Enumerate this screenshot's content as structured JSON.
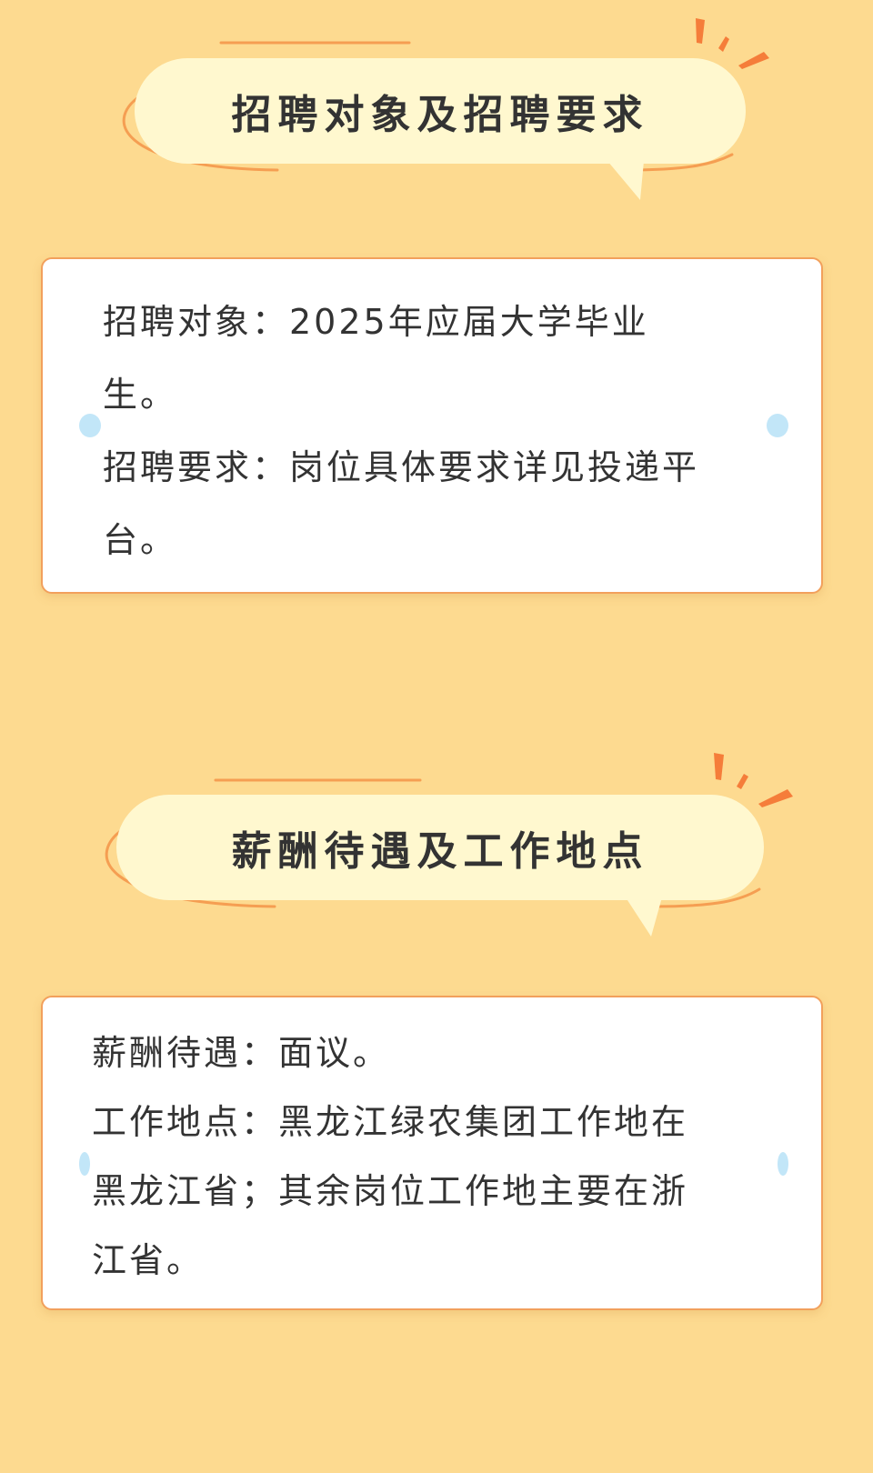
{
  "sections": [
    {
      "title": "招聘对象及招聘要求",
      "lines": [
        "招聘对象：2025年应届大学毕业",
        "生。",
        "招聘要求：岗位具体要求详见投递平",
        "台。"
      ]
    },
    {
      "title": "薪酬待遇及工作地点",
      "lines": [
        "薪酬待遇：面议。",
        "工作地点：黑龙江绿农集团工作地在",
        "黑龙江省；其余岗位工作地主要在浙",
        "江省。"
      ]
    }
  ],
  "colors": {
    "background": "#FDDA90",
    "bubble": "#FFF8CF",
    "accent": "#F59E52",
    "card_border": "#F2A05C",
    "dot": "#C2E6F8",
    "text": "#333333"
  }
}
